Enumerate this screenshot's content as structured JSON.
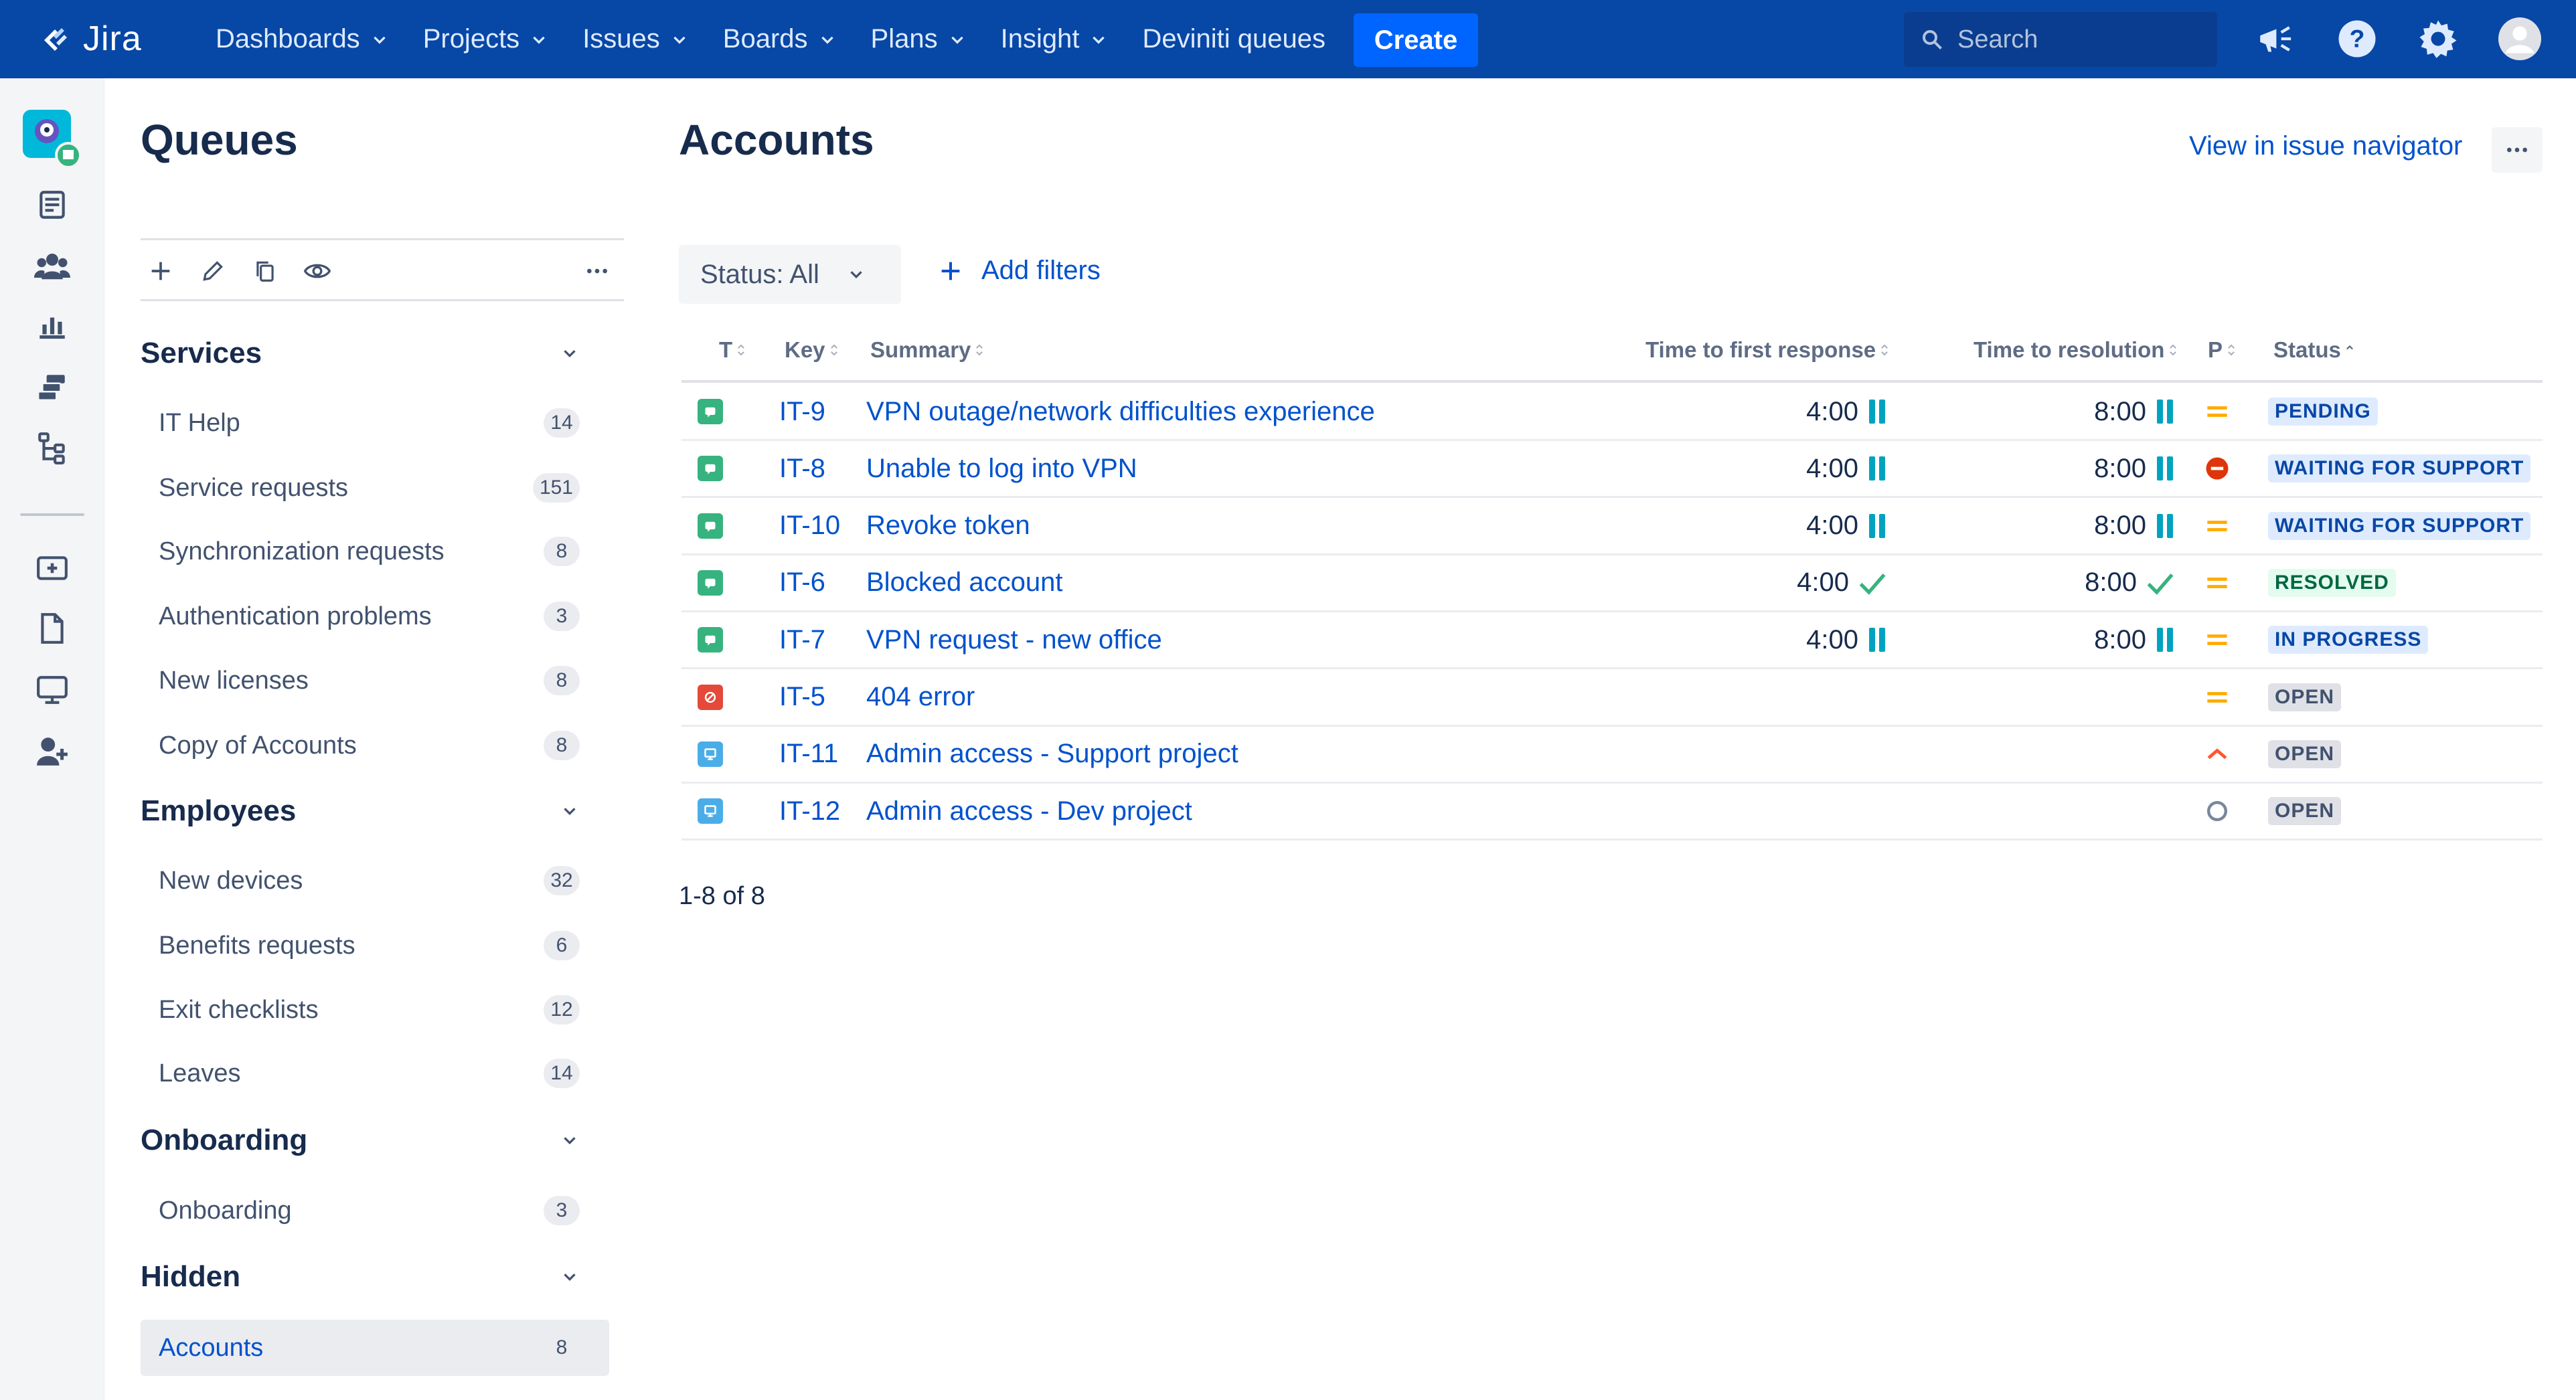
{
  "app": {
    "logo_text": "Jira"
  },
  "nav": {
    "items": [
      {
        "label": "Dashboards",
        "has_menu": true
      },
      {
        "label": "Projects",
        "has_menu": true
      },
      {
        "label": "Issues",
        "has_menu": true
      },
      {
        "label": "Boards",
        "has_menu": true
      },
      {
        "label": "Plans",
        "has_menu": true
      },
      {
        "label": "Insight",
        "has_menu": true
      },
      {
        "label": "Deviniti queues",
        "has_menu": false
      }
    ],
    "create_label": "Create",
    "search_placeholder": "Search"
  },
  "sidebar": {
    "title": "Queues",
    "groups": [
      {
        "label": "Services",
        "items": [
          {
            "label": "IT Help",
            "count": "14"
          },
          {
            "label": "Service requests",
            "count": "151"
          },
          {
            "label": "Synchronization requests",
            "count": "8"
          },
          {
            "label": "Authentication problems",
            "count": "3"
          },
          {
            "label": "New licenses",
            "count": "8"
          },
          {
            "label": "Copy of Accounts",
            "count": "8"
          }
        ]
      },
      {
        "label": "Employees",
        "items": [
          {
            "label": "New devices",
            "count": "32"
          },
          {
            "label": "Benefits requests",
            "count": "6"
          },
          {
            "label": "Exit checklists",
            "count": "12"
          },
          {
            "label": "Leaves",
            "count": "14"
          }
        ]
      },
      {
        "label": "Onboarding",
        "items": [
          {
            "label": "Onboarding",
            "count": "3"
          }
        ]
      },
      {
        "label": "Hidden",
        "items": [
          {
            "label": "Accounts",
            "count": "8",
            "active": true
          }
        ]
      }
    ]
  },
  "main": {
    "title": "Accounts",
    "view_link": "View in issue navigator",
    "status_filter": "Status: All",
    "add_filters": "Add filters",
    "columns": {
      "type": "T",
      "key": "Key",
      "summary": "Summary",
      "first_response": "Time to first response",
      "resolution": "Time to resolution",
      "priority": "P",
      "status": "Status"
    },
    "rows": [
      {
        "type": "service-request",
        "key": "IT-9",
        "summary": "VPN outage/network difficulties experience",
        "first_response": "4:00",
        "first_state": "paused",
        "resolution": "8:00",
        "resolution_state": "paused",
        "priority": "medium",
        "status": "PENDING",
        "status_color": "blue"
      },
      {
        "type": "service-request",
        "key": "IT-8",
        "summary": "Unable to log into VPN",
        "first_response": "4:00",
        "first_state": "paused",
        "resolution": "8:00",
        "resolution_state": "paused",
        "priority": "blocker",
        "status": "WAITING FOR SUPPORT",
        "status_color": "blue"
      },
      {
        "type": "service-request",
        "key": "IT-10",
        "summary": "Revoke token",
        "first_response": "4:00",
        "first_state": "paused",
        "resolution": "8:00",
        "resolution_state": "paused",
        "priority": "medium",
        "status": "WAITING FOR SUPPORT",
        "status_color": "blue"
      },
      {
        "type": "service-request",
        "key": "IT-6",
        "summary": "Blocked account",
        "first_response": "4:00",
        "first_state": "met",
        "resolution": "8:00",
        "resolution_state": "met",
        "priority": "medium",
        "status": "RESOLVED",
        "status_color": "green"
      },
      {
        "type": "service-request",
        "key": "IT-7",
        "summary": "VPN request - new office",
        "first_response": "4:00",
        "first_state": "paused",
        "resolution": "8:00",
        "resolution_state": "paused",
        "priority": "medium",
        "status": "IN PROGRESS",
        "status_color": "blue"
      },
      {
        "type": "incident",
        "key": "IT-5",
        "summary": "404 error",
        "first_response": "",
        "first_state": "",
        "resolution": "",
        "resolution_state": "",
        "priority": "medium",
        "status": "OPEN",
        "status_color": "grey"
      },
      {
        "type": "access",
        "key": "IT-11",
        "summary": "Admin access - Support project",
        "first_response": "",
        "first_state": "",
        "resolution": "",
        "resolution_state": "",
        "priority": "high",
        "status": "OPEN",
        "status_color": "grey"
      },
      {
        "type": "access",
        "key": "IT-12",
        "summary": "Admin access - Dev project",
        "first_response": "",
        "first_state": "",
        "resolution": "",
        "resolution_state": "",
        "priority": "none",
        "status": "OPEN",
        "status_color": "grey"
      }
    ],
    "pagination": "1-8 of 8"
  },
  "colors": {
    "nav_bg": "#0747A6",
    "link": "#0052CC",
    "sla_paused": "#00A3BF",
    "sla_met": "#36B37E"
  }
}
